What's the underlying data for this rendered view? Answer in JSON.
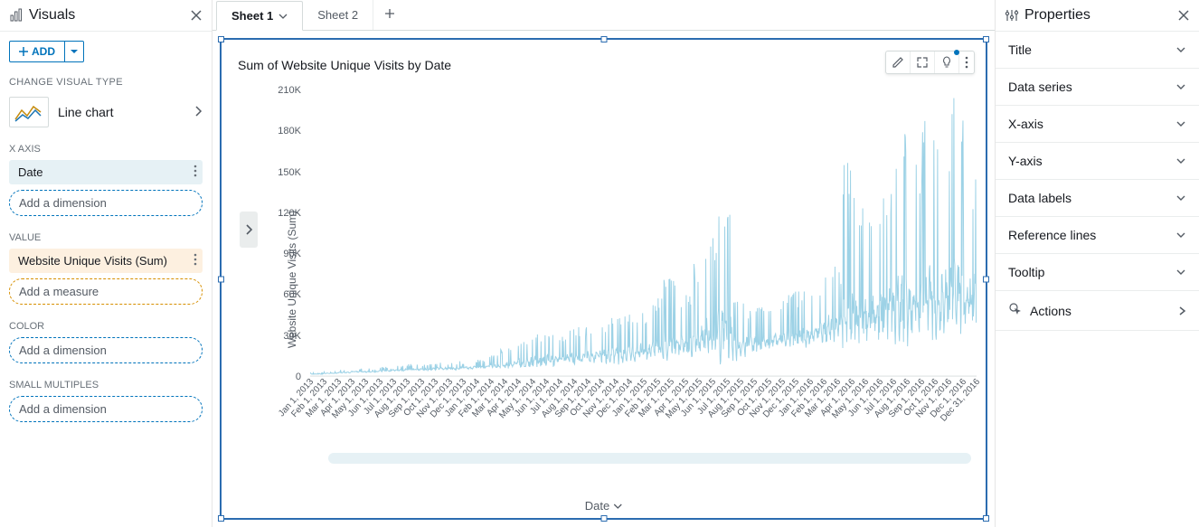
{
  "left": {
    "title": "Visuals",
    "add_label": "ADD",
    "change_label": "CHANGE VISUAL TYPE",
    "visual_type": "Line chart",
    "sections": {
      "xaxis": {
        "label": "X AXIS",
        "field": "Date",
        "placeholder": "Add a dimension"
      },
      "value": {
        "label": "VALUE",
        "field": "Website Unique Visits (Sum)",
        "placeholder": "Add a measure"
      },
      "color": {
        "label": "COLOR",
        "placeholder": "Add a dimension"
      },
      "small": {
        "label": "SMALL MULTIPLES",
        "placeholder": "Add a dimension"
      }
    }
  },
  "tabs": {
    "items": [
      "Sheet 1",
      "Sheet 2"
    ],
    "active": 0
  },
  "chart": {
    "title": "Sum of Website Unique Visits by Date",
    "ylabel": "Website Unique Visits (Sum)",
    "xlabel": "Date"
  },
  "right": {
    "title": "Properties",
    "items": [
      "Title",
      "Data series",
      "X-axis",
      "Y-axis",
      "Data labels",
      "Reference lines",
      "Tooltip"
    ],
    "actions": "Actions"
  },
  "chart_data": {
    "type": "line",
    "title": "Sum of Website Unique Visits by Date",
    "xlabel": "Date",
    "ylabel": "Website Unique Visits (Sum)",
    "ylim": [
      0,
      210000
    ],
    "y_ticks": [
      0,
      30000,
      60000,
      90000,
      120000,
      150000,
      180000,
      210000
    ],
    "y_tick_labels": [
      "0",
      "30K",
      "60K",
      "90K",
      "120K",
      "150K",
      "180K",
      "210K"
    ],
    "x_tick_labels": [
      "Jan 1, 2013",
      "Feb 1, 2013",
      "Mar 1, 2013",
      "Apr 1, 2013",
      "May 1, 2013",
      "Jun 1, 2013",
      "Jul 1, 2013",
      "Aug 1, 2013",
      "Sep 1, 2013",
      "Oct 1, 2013",
      "Nov 1, 2013",
      "Dec 1, 2013",
      "Jan 1, 2014",
      "Feb 1, 2014",
      "Mar 1, 2014",
      "Apr 1, 2014",
      "May 1, 2014",
      "Jun 1, 2014",
      "Jul 1, 2014",
      "Aug 1, 2014",
      "Sep 1, 2014",
      "Oct 1, 2014",
      "Nov 1, 2014",
      "Dec 1, 2014",
      "Jan 1, 2015",
      "Feb 1, 2015",
      "Mar 1, 2015",
      "Apr 1, 2015",
      "May 1, 2015",
      "Jun 1, 2015",
      "Jul 1, 2015",
      "Aug 1, 2015",
      "Sep 1, 2015",
      "Oct 1, 2015",
      "Nov 1, 2015",
      "Dec 1, 2015",
      "Jan 1, 2016",
      "Feb 1, 2016",
      "Mar 1, 2016",
      "Apr 1, 2016",
      "May 1, 2016",
      "Jun 1, 2016",
      "Jul 1, 2016",
      "Aug 1, 2016",
      "Sep 1, 2016",
      "Oct 1, 2016",
      "Nov 1, 2016",
      "Dec 1, 2016",
      "Dec 31, 2016"
    ],
    "approx_monthly_peak": [
      3000,
      4000,
      5000,
      6000,
      6000,
      7000,
      8000,
      9000,
      9000,
      10000,
      10000,
      11000,
      12000,
      15000,
      20000,
      25000,
      30000,
      30000,
      30000,
      35000,
      35000,
      38000,
      42000,
      45000,
      45000,
      55000,
      70000,
      60000,
      80000,
      100000,
      125000,
      60000,
      50000,
      50000,
      55000,
      60000,
      65000,
      70000,
      80000,
      150000,
      130000,
      120000,
      130000,
      170000,
      150000,
      180000,
      170000,
      195000,
      140000
    ],
    "approx_monthly_low": [
      2000,
      2500,
      3000,
      3500,
      3500,
      4000,
      4500,
      5000,
      5000,
      5500,
      5500,
      6000,
      6500,
      7000,
      7000,
      8000,
      8000,
      9000,
      10000,
      10000,
      11000,
      12000,
      12000,
      13000,
      14000,
      15000,
      16000,
      17000,
      18000,
      18000,
      19000,
      15000,
      20000,
      22000,
      23000,
      24000,
      25000,
      28000,
      30000,
      30000,
      30000,
      32000,
      34000,
      35000,
      36000,
      38000,
      40000,
      40000,
      42000
    ]
  }
}
